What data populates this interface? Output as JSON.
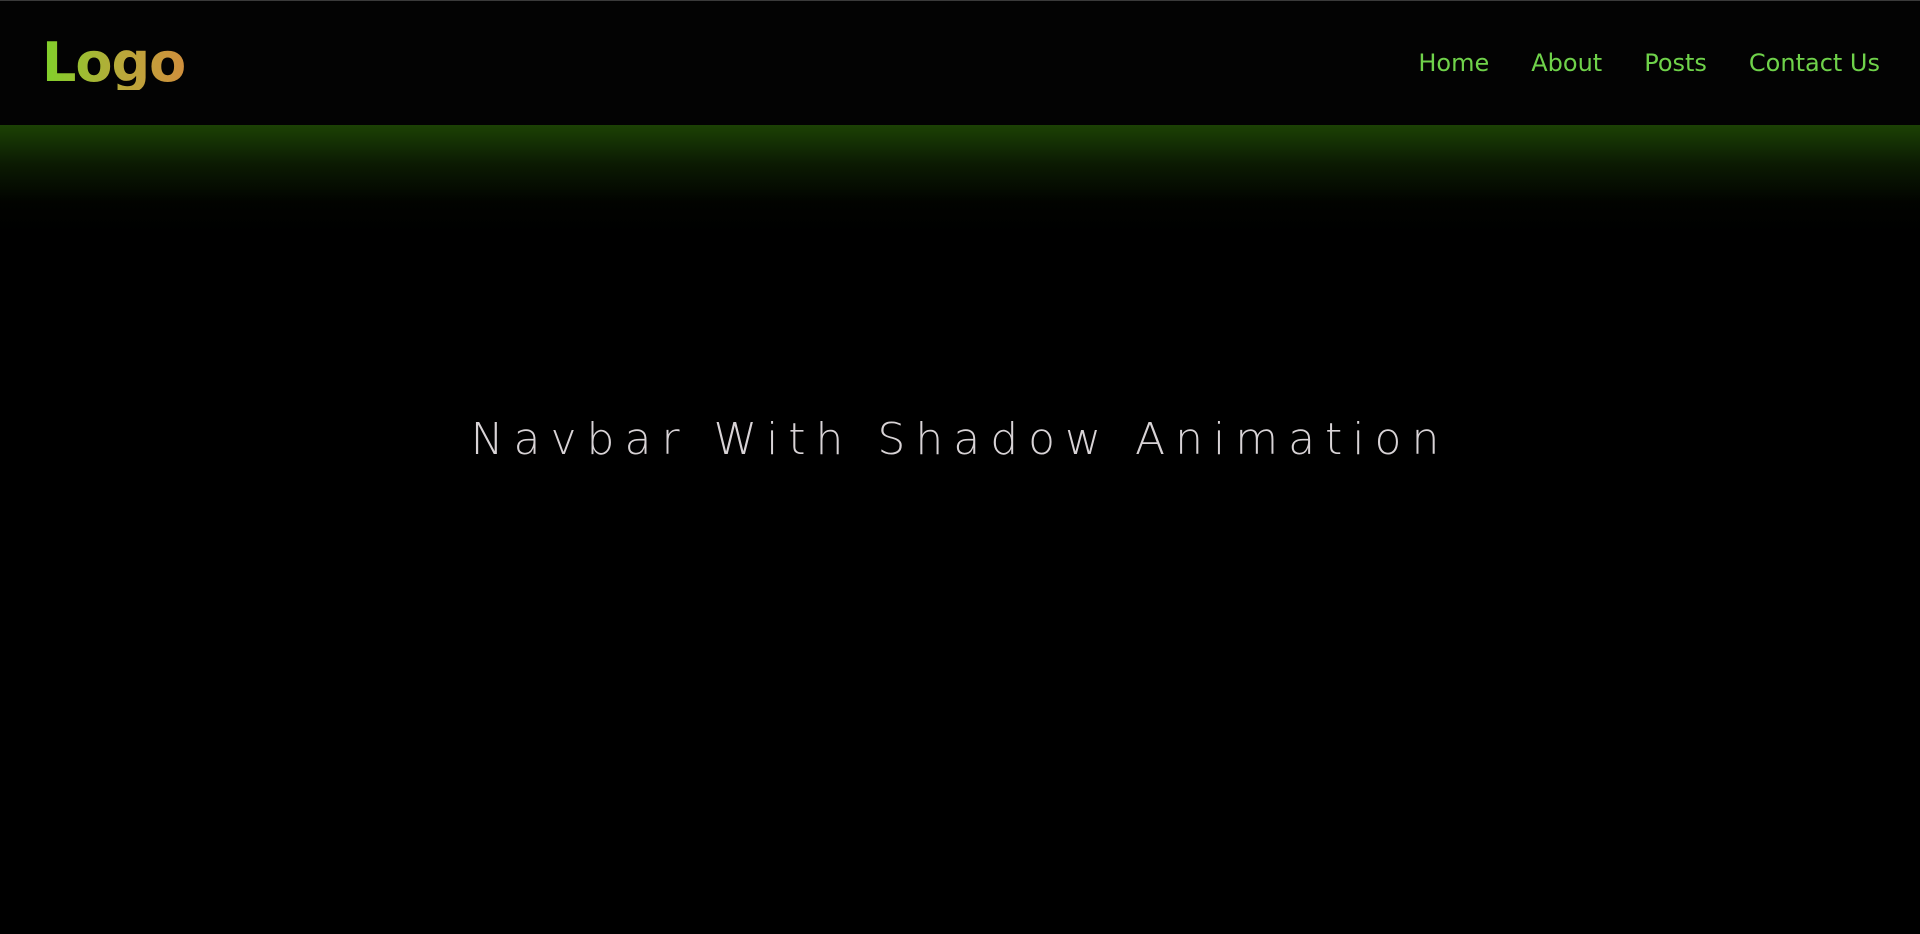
{
  "header": {
    "logo_text": "Logo",
    "nav_items": [
      {
        "label": "Home"
      },
      {
        "label": "About"
      },
      {
        "label": "Posts"
      },
      {
        "label": "Contact Us"
      }
    ]
  },
  "main": {
    "title": "Navbar With Shadow Animation"
  },
  "colors": {
    "background": "#000000",
    "nav_link": "#6fd24a",
    "logo_gradient_start": "#7fd12a",
    "logo_gradient_end": "#d08f3c",
    "glow": "#245406",
    "title_text": "#d8d3d6"
  }
}
